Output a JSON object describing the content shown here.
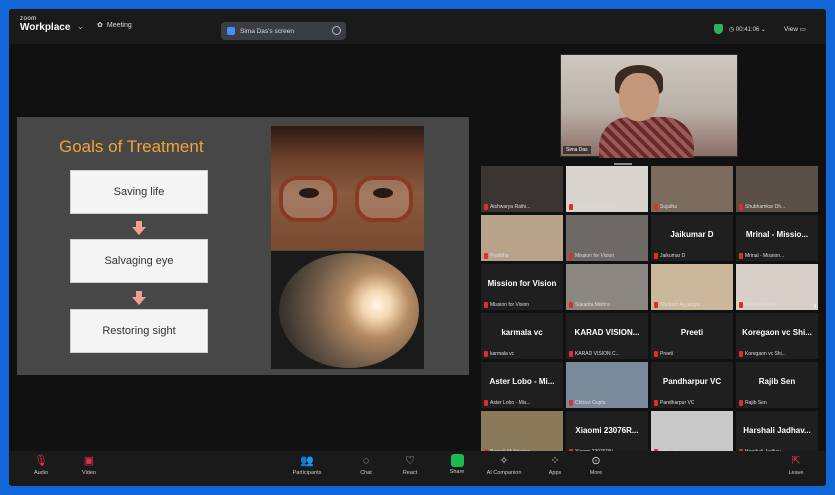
{
  "topbar": {
    "brand_line1": "zoom",
    "brand_line2": "Workplace",
    "meeting_label": "Meeting",
    "share_pill": "Sima Das's screen",
    "timer": "00:41:06",
    "view_label": "View"
  },
  "slide": {
    "title": "Goals of Treatment",
    "goals": [
      "Saving life",
      "Salvaging  eye",
      "Restoring sight"
    ]
  },
  "active_speaker": {
    "name": "Sima Das"
  },
  "participants": [
    {
      "name": "Aishwarya Rathi...",
      "big": "",
      "video": true,
      "bg": "#3a3530"
    },
    {
      "name": "Dhanraj Meherta...",
      "big": "",
      "video": true,
      "bg": "#d8d4ce"
    },
    {
      "name": "Sujatha",
      "big": "",
      "video": true,
      "bg": "#7a6b5c"
    },
    {
      "name": "Shubhamkar Dh...",
      "big": "",
      "video": true,
      "bg": "#5a5048"
    },
    {
      "name": "Pratibha",
      "big": "",
      "video": true,
      "bg": "#b9a28a"
    },
    {
      "name": "Mission for Vision",
      "big": "",
      "video": true,
      "bg": "#6d6a66"
    },
    {
      "name": "Jaikumar D",
      "big": "Jaikumar D",
      "video": false,
      "bg": ""
    },
    {
      "name": "Mrinal - Mission...",
      "big": "Mrinal - Missio...",
      "video": false,
      "bg": ""
    },
    {
      "name": "Mission for Vision",
      "big": "Mission for Vision",
      "video": false,
      "bg": ""
    },
    {
      "name": "Sukanta Mishra",
      "big": "",
      "video": true,
      "bg": "#8a8680"
    },
    {
      "name": "Shrikant Ayyangar",
      "big": "",
      "video": true,
      "bg": "#cbb89a"
    },
    {
      "name": "Pinaki Kanrar",
      "big": "",
      "video": true,
      "bg": "#d8d0c8"
    },
    {
      "name": "karmala vc",
      "big": "karmala vc",
      "video": false,
      "bg": ""
    },
    {
      "name": "KARAD VISION C...",
      "big": "KARAD VISION...",
      "video": false,
      "bg": ""
    },
    {
      "name": "Preeti",
      "big": "Preeti",
      "video": false,
      "bg": ""
    },
    {
      "name": "Koregaon vc Shi...",
      "big": "Koregaon vc Shi...",
      "video": false,
      "bg": ""
    },
    {
      "name": "Aster Lobo - Mis...",
      "big": "Aster Lobo - Mi...",
      "video": false,
      "bg": ""
    },
    {
      "name": "Chhavi Gupta",
      "big": "",
      "video": true,
      "bg": "#7a8a9a"
    },
    {
      "name": "Pandharpur VC",
      "big": "Pandharpur VC",
      "video": false,
      "bg": ""
    },
    {
      "name": "Rajib Sen",
      "big": "Rajib Sen",
      "video": false,
      "bg": ""
    },
    {
      "name": "Barnali Mukherjee",
      "big": "",
      "video": true,
      "bg": "#8a7a5a"
    },
    {
      "name": "Xiaomi 23076RN...",
      "big": "Xiaomi 23076R...",
      "video": false,
      "bg": ""
    },
    {
      "name": "dilip patil",
      "big": "",
      "video": true,
      "bg": "#c8c8c8"
    },
    {
      "name": "Harshali Jadhav...",
      "big": "Harshali Jadhav...",
      "video": false,
      "bg": ""
    }
  ],
  "toolbar": {
    "audio": "Audio",
    "video": "Video",
    "participants": "Participants",
    "participants_count": "48",
    "chat": "Chat",
    "react": "React",
    "share": "Share",
    "ai_companion": "AI Companion",
    "apps": "Apps",
    "more": "More",
    "leave": "Leave"
  },
  "colors": {
    "frame": "#1267d8",
    "accent_title": "#f0a43a",
    "share_green": "#1db954",
    "muted_red": "#e02d2d"
  }
}
